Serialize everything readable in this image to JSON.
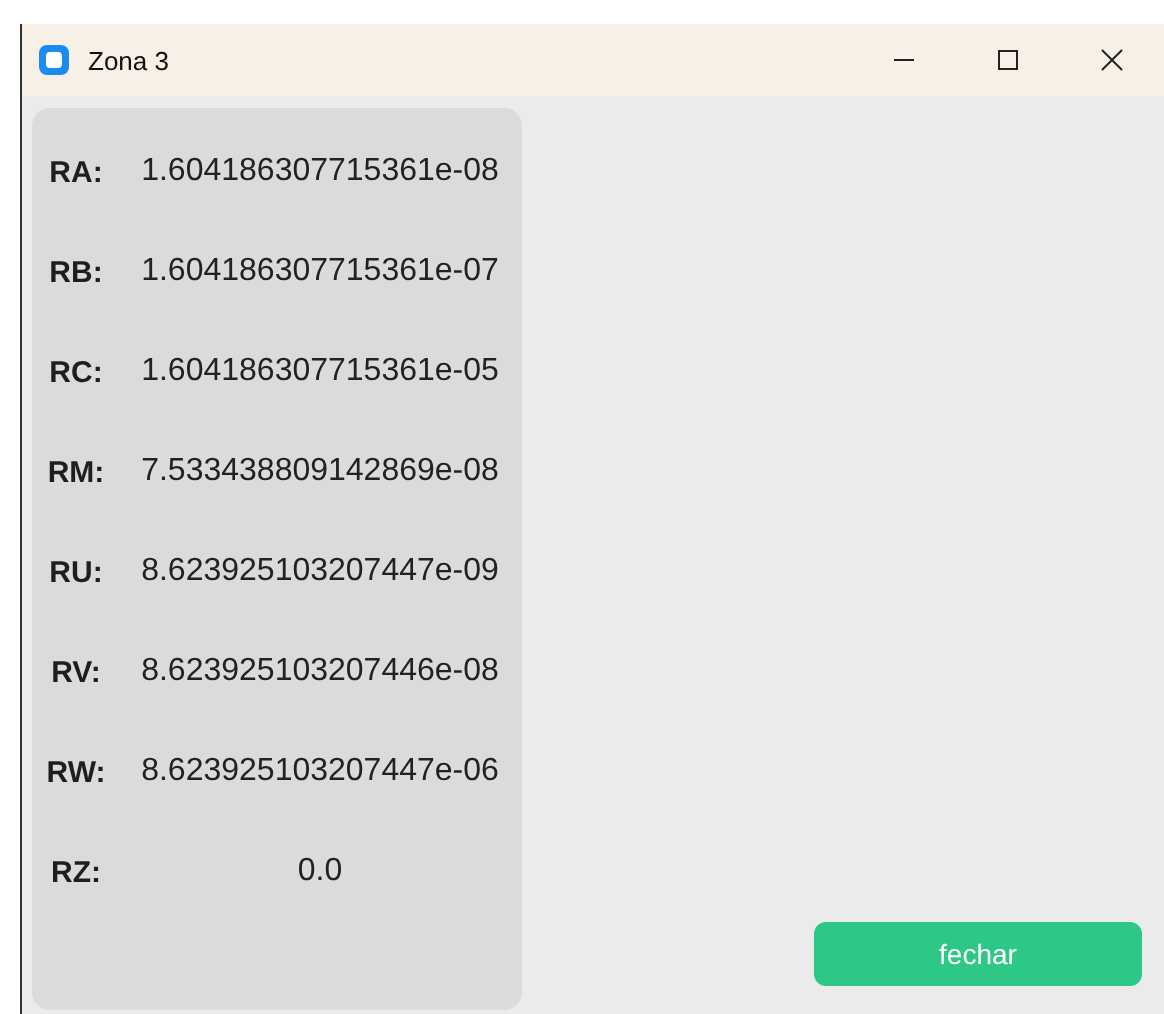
{
  "window": {
    "title": "Zona 3"
  },
  "results": [
    {
      "label": "RA:",
      "value": "1.604186307715361e-08"
    },
    {
      "label": "RB:",
      "value": "1.604186307715361e-07"
    },
    {
      "label": "RC:",
      "value": "1.604186307715361e-05"
    },
    {
      "label": "RM:",
      "value": "7.533438809142869e-08"
    },
    {
      "label": "RU:",
      "value": "8.623925103207447e-09"
    },
    {
      "label": "RV:",
      "value": "8.623925103207446e-08"
    },
    {
      "label": "RW:",
      "value": "8.623925103207447e-06"
    },
    {
      "label": "RZ:",
      "value": "0.0"
    }
  ],
  "buttons": [
    {
      "label": "fechar"
    }
  ]
}
